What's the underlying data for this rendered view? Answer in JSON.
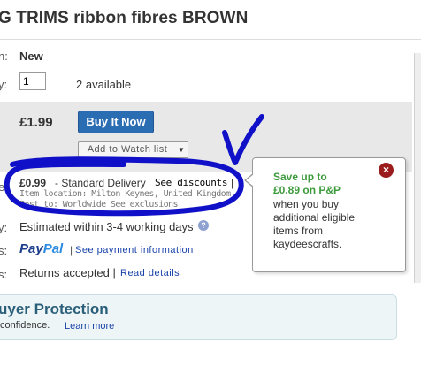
{
  "listing": {
    "title": "G TRIMS ribbon fibres BROWN",
    "condition_label": "n:",
    "condition_value": "New",
    "quantity_label": "y:",
    "quantity_value": "1",
    "available_text": "2 available"
  },
  "purchase": {
    "price": "£1.99",
    "buy_now_label": "Buy It Now",
    "watch_label": "Add to Watch list",
    "watch_arrow": "▼"
  },
  "shipping": {
    "label": "e:",
    "cost": "£0.99",
    "service": "- Standard Delivery",
    "discounts_link": "See discounts",
    "separator": "|",
    "item_location": "Item location: Milton Keynes, United Kingdom",
    "post_to": "Post to: Worldwide See exclusions"
  },
  "delivery": {
    "label": "y:",
    "value": "Estimated within 3-4 working days",
    "help_icon": "?"
  },
  "payments": {
    "label": "s:",
    "paypal_part1": "Pay",
    "paypal_part2": "Pal",
    "separator": "|",
    "link": "See payment information"
  },
  "returns": {
    "label": "s:",
    "value": "Returns accepted |",
    "link": "Read details"
  },
  "protection": {
    "title": "uyer Protection",
    "text": "confidence.",
    "link": "Learn more"
  },
  "popup": {
    "title": "Save up to £0.89 on P&P",
    "body": "when you buy additional eligible items from kaydeescrafts.",
    "close_icon": "×"
  },
  "colors": {
    "buy_button": "#2a6db3",
    "popup_title": "#3c9b3c",
    "annotation_ink": "#1010c8",
    "close_button": "#9b1c1c"
  }
}
